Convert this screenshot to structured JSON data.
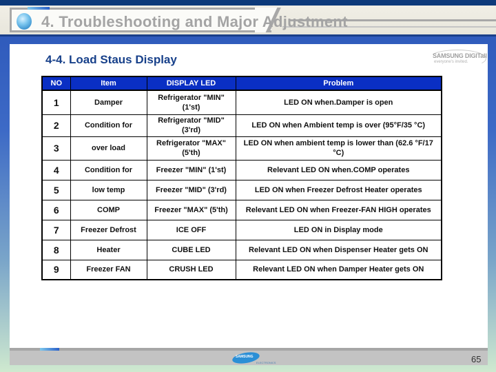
{
  "header": {
    "title": "4. Troubleshooting and Major Adjustment"
  },
  "section": {
    "title": "4-4. Load Staus Display"
  },
  "brand": {
    "logo_text": "SAMSUNG DIGITall",
    "tagline": "everyone's invited.",
    "footer_logo_text": "SAMSUNG",
    "footer_logo_sub": "ELECTRONICS"
  },
  "table": {
    "headers": [
      "NO",
      "Item",
      "DISPLAY LED",
      "Problem"
    ],
    "rows": [
      {
        "no": "1",
        "item": "Damper",
        "led": "Refrigerator \"MIN\" (1'st)",
        "problem": "LED ON when.Damper is open"
      },
      {
        "no": "2",
        "item": "Condition for",
        "led": "Refrigerator \"MID\" (3'rd)",
        "problem": "LED ON when Ambient temp is over (95°F/35 °C)"
      },
      {
        "no": "3",
        "item": "over load",
        "led": "Refrigerator \"MAX\" (5'th)",
        "problem": "LED ON when ambient temp is lower than (62.6 °F/17 °C)"
      },
      {
        "no": "4",
        "item": "Condition for",
        "led": "Freezer \"MIN\" (1'st)",
        "problem": "Relevant LED ON when.COMP operates"
      },
      {
        "no": "5",
        "item": "low temp",
        "led": "Freezer \"MID\" (3'rd)",
        "problem": "LED ON when Freezer Defrost Heater operates"
      },
      {
        "no": "6",
        "item": "COMP",
        "led": "Freezer \"MAX\" (5'th)",
        "problem": "Relevant LED ON when Freezer-FAN HIGH operates"
      },
      {
        "no": "7",
        "item": "Freezer Defrost",
        "led": "ICE OFF",
        "problem": "LED ON in Display mode"
      },
      {
        "no": "8",
        "item": "Heater",
        "led": "CUBE LED",
        "problem": "Relevant LED ON when Dispenser Heater gets ON"
      },
      {
        "no": "9",
        "item": "Freezer FAN",
        "led": "CRUSH LED",
        "problem": "Relevant LED ON when Damper Heater gets ON"
      }
    ]
  },
  "footer": {
    "page_number": "65"
  },
  "colors": {
    "table_header_bg": "#0a2fc4",
    "section_title": "#17408a",
    "page_title": "#a4a4a4"
  }
}
